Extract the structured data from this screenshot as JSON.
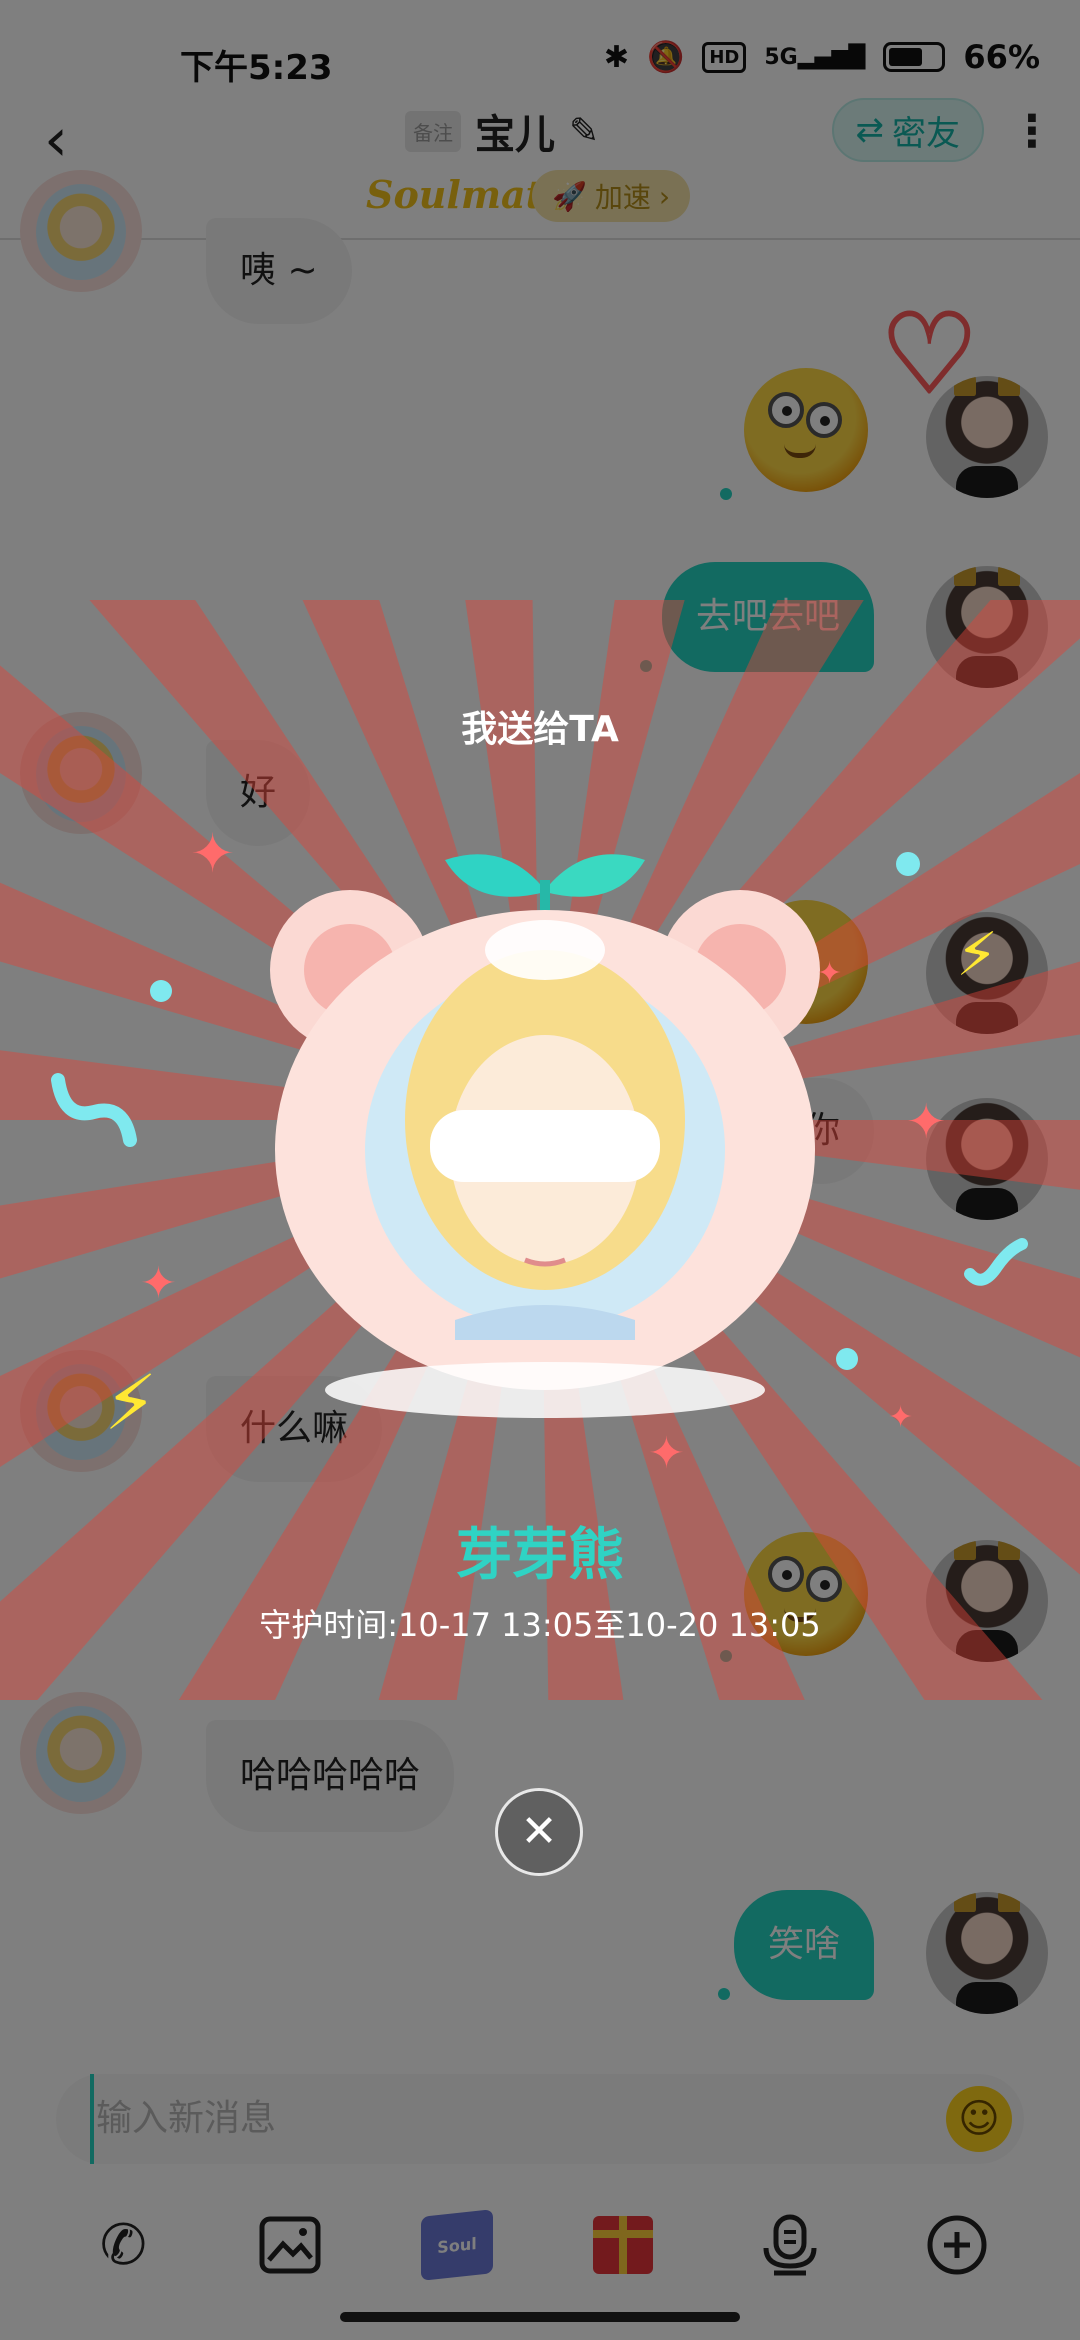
{
  "status_bar": {
    "time": "下午5:23",
    "network": "5G",
    "hd": "HD",
    "battery_percent": "66%",
    "battery_level": 0.66
  },
  "header": {
    "remark_tag": "备注",
    "title": "宝儿",
    "close_friend_label": "密友",
    "soulmate_label": "Soulmate",
    "boost_label": "加速"
  },
  "messages": {
    "m1": "咦 ~",
    "m2": "去吧去吧",
    "m3": "好",
    "m4": "你",
    "m5": "什么嘛",
    "m6": "哈哈哈哈哈",
    "m7": "笑啥"
  },
  "gift_overlay": {
    "title": "我送给TA",
    "gift_name": "芽芽熊",
    "guard_period": "守护时间:10-17 13:05至10-20 13:05",
    "close_symbol": "✕"
  },
  "input": {
    "placeholder": "输入新消息"
  },
  "box_label": "Soul",
  "colors": {
    "accent": "#25d4c3",
    "soulmate_gold": "#f0c11b",
    "ray_red": "#e0443a"
  },
  "icons": {
    "back": "chevron-left-icon",
    "edit": "edit-icon",
    "more": "more-vertical-icon",
    "phone": "phone-icon",
    "image": "image-icon",
    "box": "mystery-box-icon",
    "gift": "gift-icon",
    "voice": "voice-icon",
    "plus": "plus-circle-icon"
  }
}
